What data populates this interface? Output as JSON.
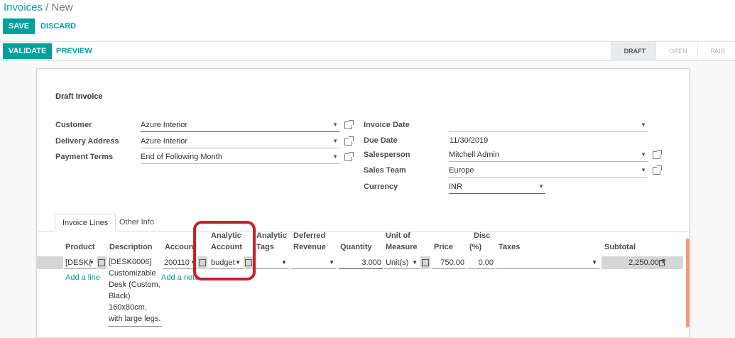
{
  "breadcrumb": {
    "root": "Invoices",
    "separator": "/",
    "current": "New"
  },
  "actions": {
    "save": "SAVE",
    "discard": "DISCARD",
    "validate": "VALIDATE",
    "preview": "PREVIEW"
  },
  "stages": [
    {
      "label": "DRAFT",
      "active": true
    },
    {
      "label": "OPEN",
      "active": false
    },
    {
      "label": "PAID",
      "active": false
    }
  ],
  "form": {
    "title": "Draft Invoice",
    "customer": {
      "label": "Customer",
      "value": "Azure Interior"
    },
    "delivery_address": {
      "label": "Delivery Address",
      "value": "Azure Interior"
    },
    "payment_terms": {
      "label": "Payment Terms",
      "value": "End of Following Month"
    },
    "invoice_date": {
      "label": "Invoice Date",
      "value": ""
    },
    "due_date": {
      "label": "Due Date",
      "value": "11/30/2019"
    },
    "salesperson": {
      "label": "Salesperson",
      "value": "Mitchell Admin"
    },
    "sales_team": {
      "label": "Sales Team",
      "value": "Europe"
    },
    "currency": {
      "label": "Currency",
      "value": "INR"
    }
  },
  "tabs": [
    {
      "label": "Invoice Lines",
      "active": true
    },
    {
      "label": "Other Info",
      "active": false
    }
  ],
  "columns": {
    "product": "Product",
    "description": "Description",
    "account": "Account",
    "analytic_account_l1": "Analytic",
    "analytic_account_l2": "Account",
    "analytic_tags_l1": "Analytic",
    "analytic_tags_l2": "Tags",
    "deferred_l1": "Deferred",
    "deferred_l2": "Revenue",
    "quantity": "Quantity",
    "uom_l1": "Unit of",
    "uom_l2": "Measure",
    "price": "Price",
    "disc_l1": "Disc",
    "disc_l2": "(%)",
    "taxes": "Taxes",
    "subtotal": "Subtotal"
  },
  "line": {
    "product": "[DESK(",
    "description_lines": [
      "[DESK0006]",
      "Customizable",
      "Desk (Custom,",
      "Black)",
      "160x80cm,",
      "with large legs."
    ],
    "account": "200110",
    "analytic_account": "budget",
    "quantity": "3.000",
    "uom": "Unit(s)",
    "price": "750.00",
    "discount": "0.00",
    "subtotal": "2,250.00 ₹"
  },
  "links": {
    "add_line": "Add a line",
    "add_note": "Add a note"
  },
  "colors": {
    "accent": "#00a09d",
    "highlight": "#cc1f26"
  }
}
